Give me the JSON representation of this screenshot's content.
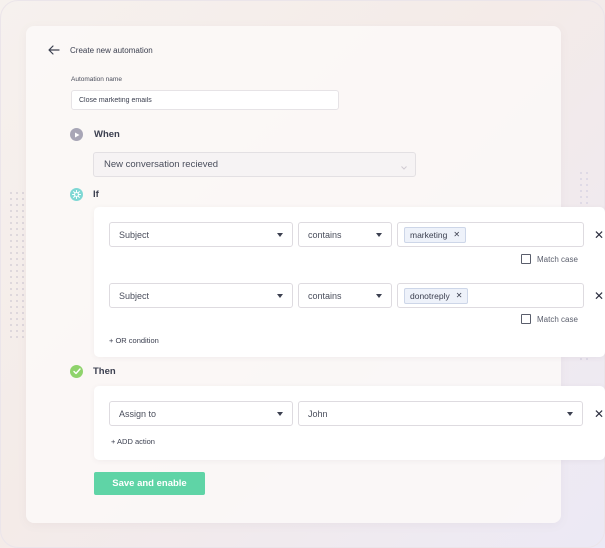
{
  "header": {
    "title": "Create new automation",
    "back_icon": "arrow-left-icon"
  },
  "automation_name": {
    "label": "Automation name",
    "value": "Close marketing emails"
  },
  "when": {
    "label": "When",
    "icon": "play-icon",
    "trigger": "New conversation recieved"
  },
  "if": {
    "label": "If",
    "icon": "settings-cog-icon",
    "conditions": [
      {
        "field": "Subject",
        "operator": "contains",
        "value": "marketing",
        "match_case_label": "Match case"
      },
      {
        "field": "Subject",
        "operator": "contains",
        "value": "donotreply",
        "match_case_label": "Match case"
      }
    ],
    "add_condition_label": "+ OR condition"
  },
  "then": {
    "label": "Then",
    "icon": "check-circle-icon",
    "actions": [
      {
        "action": "Assign to",
        "target": "John"
      }
    ],
    "add_action_label": "+ ADD action"
  },
  "save_label": "Save and enable",
  "colors": {
    "primary_green": "#5fd4a6",
    "when_icon": "#a8a6b6",
    "if_icon": "#7fd8d4",
    "then_icon": "#8fd36c",
    "text": "#3c4050"
  }
}
